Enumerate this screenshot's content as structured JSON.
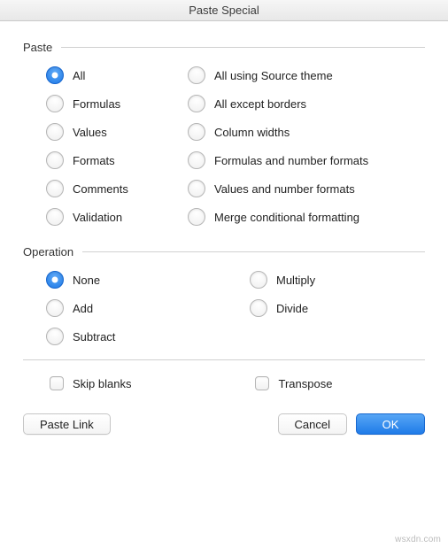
{
  "title": "Paste Special",
  "groups": {
    "paste": {
      "label": "Paste",
      "selected": "all",
      "left": [
        {
          "id": "all",
          "label": "All"
        },
        {
          "id": "formulas",
          "label": "Formulas"
        },
        {
          "id": "values",
          "label": "Values"
        },
        {
          "id": "formats",
          "label": "Formats"
        },
        {
          "id": "comments",
          "label": "Comments"
        },
        {
          "id": "validation",
          "label": "Validation"
        }
      ],
      "right": [
        {
          "id": "all_source_theme",
          "label": "All using Source theme"
        },
        {
          "id": "all_except_borders",
          "label": "All except borders"
        },
        {
          "id": "column_widths",
          "label": "Column widths"
        },
        {
          "id": "formulas_number_formats",
          "label": "Formulas and number formats"
        },
        {
          "id": "values_number_formats",
          "label": "Values and number formats"
        },
        {
          "id": "merge_conditional",
          "label": "Merge conditional formatting"
        }
      ]
    },
    "operation": {
      "label": "Operation",
      "selected": "none",
      "left": [
        {
          "id": "none",
          "label": "None"
        },
        {
          "id": "add",
          "label": "Add"
        },
        {
          "id": "subtract",
          "label": "Subtract"
        }
      ],
      "right": [
        {
          "id": "multiply",
          "label": "Multiply"
        },
        {
          "id": "divide",
          "label": "Divide"
        }
      ]
    }
  },
  "checks": {
    "skip_blanks": {
      "label": "Skip blanks",
      "checked": false
    },
    "transpose": {
      "label": "Transpose",
      "checked": false
    }
  },
  "buttons": {
    "paste_link": "Paste Link",
    "cancel": "Cancel",
    "ok": "OK"
  },
  "watermark": "wsxdn.com"
}
